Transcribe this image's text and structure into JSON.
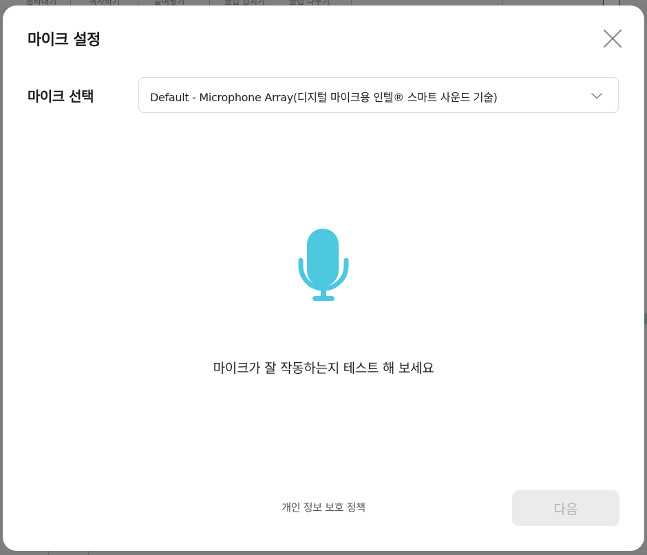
{
  "background_app": {
    "toolbar_items": [
      "잘라내기",
      "복사하기",
      "붙여넣기",
      "클립 합치기",
      "클립 나누기"
    ]
  },
  "dialog": {
    "title": "마이크 설정",
    "close_icon": "close-icon",
    "mic_select": {
      "label": "마이크 선택",
      "selected_value": "Default - Microphone Array(디지털 마이크용 인텔® 스마트 사운드 기술)",
      "dropdown_icon": "chevron-down-icon"
    },
    "mic_icon": "microphone-icon",
    "test_prompt": "마이크가 잘 작동하는지 테스트 해 보세요",
    "privacy_link": "개인 정보 보호 정책",
    "next_button": {
      "label": "다음",
      "enabled": false
    }
  },
  "colors": {
    "accent": "#4dc8df",
    "overlay": "#7d7d7d",
    "disabled_button_bg": "#ebebeb",
    "disabled_button_text": "#b3b3b3"
  }
}
